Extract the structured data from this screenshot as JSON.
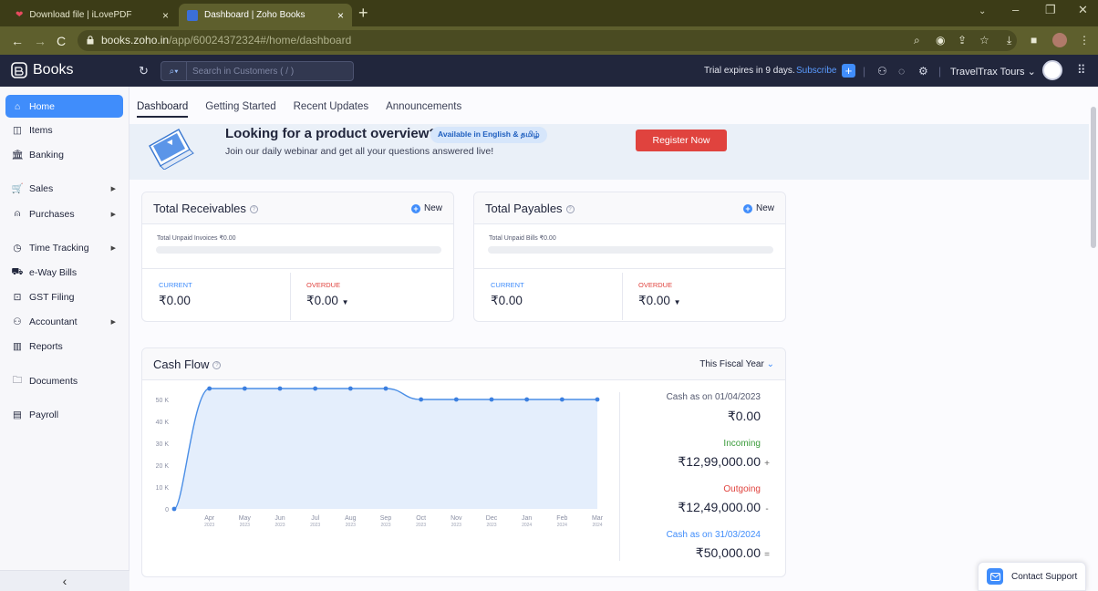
{
  "browser": {
    "tabs": [
      {
        "title": "Download file | iLovePDF",
        "active": false
      },
      {
        "title": "Dashboard | Zoho Books",
        "active": true
      }
    ],
    "url_domain": "books.zoho.in",
    "url_path": "/app/60024372324#/home/dashboard"
  },
  "app": {
    "brand": "Books",
    "search_placeholder": "Search in Customers ( / )",
    "trial_text": "Trial expires in 9 days.",
    "subscribe_label": "Subscribe",
    "org_name": "TravelTrax Tours"
  },
  "sidebar": {
    "items": [
      {
        "label": "Home",
        "icon": "home-icon",
        "active": true
      },
      {
        "label": "Items",
        "icon": "items-icon"
      },
      {
        "label": "Banking",
        "icon": "bank-icon"
      },
      {
        "label": "Sales",
        "icon": "cart-icon",
        "expandable": true
      },
      {
        "label": "Purchases",
        "icon": "bag-icon",
        "expandable": true
      },
      {
        "label": "Time Tracking",
        "icon": "clock-icon",
        "expandable": true
      },
      {
        "label": "e-Way Bills",
        "icon": "truck-icon"
      },
      {
        "label": "GST Filing",
        "icon": "gst-icon"
      },
      {
        "label": "Accountant",
        "icon": "accountant-icon",
        "expandable": true
      },
      {
        "label": "Reports",
        "icon": "reports-icon"
      },
      {
        "label": "Documents",
        "icon": "folder-icon"
      },
      {
        "label": "Payroll",
        "icon": "payroll-icon"
      }
    ],
    "collapse_glyph": "‹"
  },
  "tabs": [
    "Dashboard",
    "Getting Started",
    "Recent Updates",
    "Announcements"
  ],
  "banner": {
    "title": "Looking for a product overview?",
    "badge": "Available in English & தமிழ்",
    "subtitle": "Join our daily webinar and get all your questions answered live!",
    "button": "Register Now"
  },
  "receivables": {
    "title": "Total Receivables",
    "new_label": "New",
    "unpaid_text": "Total Unpaid Invoices ₹0.00",
    "current_label": "CURRENT",
    "current_value": "₹0.00",
    "overdue_label": "OVERDUE",
    "overdue_value": "₹0.00"
  },
  "payables": {
    "title": "Total Payables",
    "new_label": "New",
    "unpaid_text": "Total Unpaid Bills ₹0.00",
    "current_label": "CURRENT",
    "current_value": "₹0.00",
    "overdue_label": "OVERDUE",
    "overdue_value": "₹0.00"
  },
  "cashflow": {
    "title": "Cash Flow",
    "period": "This Fiscal Year",
    "opening_label": "Cash as on 01/04/2023",
    "opening_value": "₹0.00",
    "incoming_label": "Incoming",
    "incoming_value": "₹12,99,000.00",
    "incoming_op": "+",
    "outgoing_label": "Outgoing",
    "outgoing_value": "₹12,49,000.00",
    "outgoing_op": "-",
    "closing_label": "Cash as on 31/03/2024",
    "closing_value": "₹50,000.00",
    "closing_op": "="
  },
  "support_label": "Contact Support",
  "colors": {
    "accent": "#408dfb",
    "danger": "#e0433e",
    "incoming": "#3a9b3a",
    "topbar": "#21263c"
  },
  "chart_data": {
    "type": "area",
    "categories": [
      "",
      "Apr 2023",
      "May 2023",
      "Jun 2023",
      "Jul 2023",
      "Aug 2023",
      "Sep 2023",
      "Oct 2023",
      "Nov 2023",
      "Dec 2023",
      "Jan 2024",
      "Feb 2024",
      "Mar 2024"
    ],
    "tick_labels": [
      {
        "m": "Apr",
        "y": "2023"
      },
      {
        "m": "May",
        "y": "2023"
      },
      {
        "m": "Jun",
        "y": "2023"
      },
      {
        "m": "Jul",
        "y": "2023"
      },
      {
        "m": "Aug",
        "y": "2023"
      },
      {
        "m": "Sep",
        "y": "2023"
      },
      {
        "m": "Oct",
        "y": "2023"
      },
      {
        "m": "Nov",
        "y": "2023"
      },
      {
        "m": "Dec",
        "y": "2023"
      },
      {
        "m": "Jan",
        "y": "2024"
      },
      {
        "m": "Feb",
        "y": "2024"
      },
      {
        "m": "Mar",
        "y": "2024"
      }
    ],
    "values": [
      0,
      55000,
      55000,
      55000,
      55000,
      55000,
      55000,
      50000,
      50000,
      50000,
      50000,
      50000,
      50000
    ],
    "yticks": [
      0,
      10000,
      20000,
      30000,
      40000,
      50000
    ],
    "ytick_labels": [
      "0",
      "10 K",
      "20 K",
      "30 K",
      "40 K",
      "50 K"
    ],
    "ylim": [
      0,
      60000
    ],
    "grid": false
  }
}
